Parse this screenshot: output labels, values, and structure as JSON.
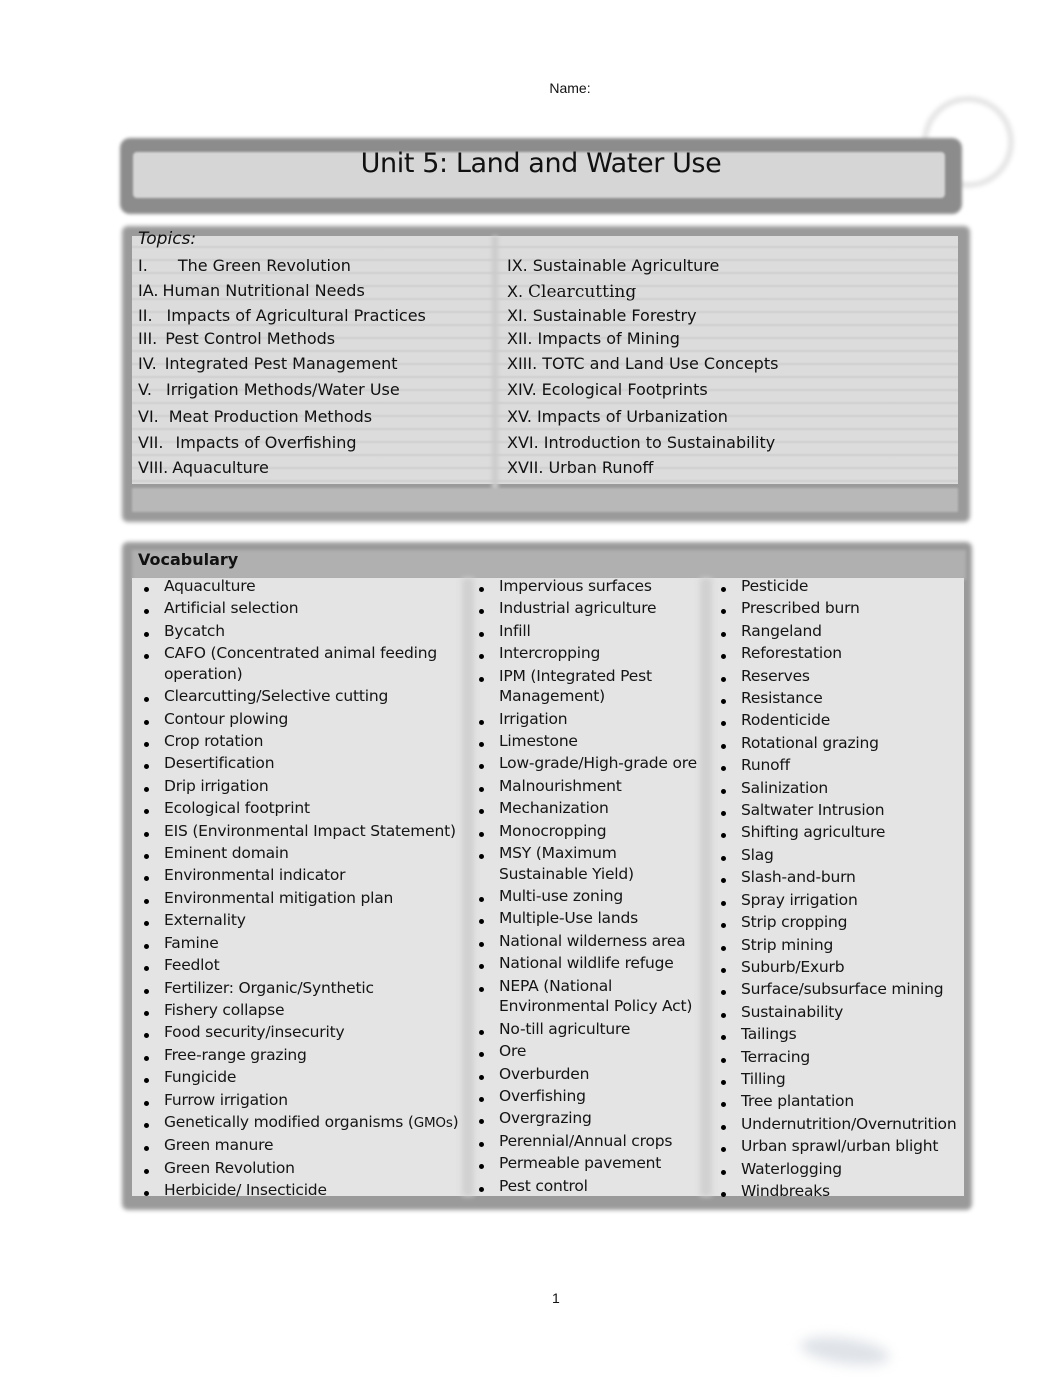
{
  "header": {
    "name_label": "Name:",
    "title": "Unit 5: Land and Water Use"
  },
  "topics": {
    "heading": "Topics:",
    "left": [
      {
        "num": "I.",
        "label": "The Green Revolution"
      },
      {
        "num": "IA.",
        "label": "Human Nutritional Needs"
      },
      {
        "num": "II.",
        "label": "Impacts of Agricultural Practices"
      },
      {
        "num": "III.",
        "label": "Pest Control Methods"
      },
      {
        "num": "IV.",
        "label": "Integrated Pest Management"
      },
      {
        "num": "V.",
        "label": "Irrigation Methods/Water Use"
      },
      {
        "num": "VI.",
        "label": "Meat Production Methods"
      },
      {
        "num": "VII.",
        "label": "Impacts of Overfishing"
      },
      {
        "num": "VIII.",
        "label": "Aquaculture"
      }
    ],
    "right": [
      {
        "num": "IX.",
        "label": "Sustainable Agriculture"
      },
      {
        "num": "X.",
        "label": "Clearcutting"
      },
      {
        "num": "XI.",
        "label": "Sustainable Forestry"
      },
      {
        "num": "XII.",
        "label": "Impacts of Mining"
      },
      {
        "num": "XIII.",
        "label": "TOTC and Land Use Concepts"
      },
      {
        "num": "XIV.",
        "label": "Ecological Footprints"
      },
      {
        "num": "XV.",
        "label": "Impacts of Urbanization"
      },
      {
        "num": "XVI.",
        "label": "Introduction to Sustainability"
      },
      {
        "num": "XVII.",
        "label": "Urban Runoff"
      }
    ]
  },
  "vocabulary": {
    "heading": "Vocabulary",
    "columns": [
      [
        "Aquaculture",
        "Artificial selection",
        "Bycatch",
        "CAFO (Concentrated animal feeding|operation)",
        "Clearcutting/Selective cutting",
        "Contour plowing",
        "Crop rotation",
        "Desertification",
        "Drip irrigation",
        "Ecological footprint",
        "EIS (Environmental Impact Statement)",
        "Eminent domain",
        "Environmental indicator",
        "Environmental mitigation plan",
        "Externality",
        "Famine",
        "Feedlot",
        "Fertilizer: Organic/Synthetic",
        "Fishery collapse",
        "Food security/insecurity",
        "Free-range grazing",
        "Fungicide",
        "Furrow irrigation",
        "Genetically modified organisms (GMOs)",
        "Green manure",
        "Green Revolution",
        "Herbicide/ Insecticide"
      ],
      [
        "Impervious surfaces",
        "Industrial agriculture",
        "Infill",
        "Intercropping",
        "IPM (Integrated Pest|Management)",
        "Irrigation",
        "Limestone",
        "Low-grade/High-grade ore",
        "Malnourishment",
        "Mechanization",
        "Monocropping",
        "MSY (Maximum|Sustainable Yield)",
        "Multi-use zoning",
        "Multiple-Use lands",
        "National wilderness area",
        "National wildlife refuge",
        "NEPA (National|Environmental  Policy Act)",
        "No-till agriculture",
        "Ore",
        "Overburden",
        "Overfishing",
        "Overgrazing",
        "Perennial/Annual crops",
        "Permeable pavement",
        "Pest control"
      ],
      [
        "Pesticide",
        "Prescribed burn",
        "Rangeland",
        "Reforestation",
        "Reserves",
        "Resistance",
        "Rodenticide",
        "Rotational grazing",
        "Runoff",
        "Salinization",
        "Saltwater Intrusion",
        "Shifting agriculture",
        "Slag",
        "Slash-and-burn",
        "Spray irrigation",
        "Strip cropping",
        "Strip mining",
        "Suburb/Exurb",
        "Surface/subsurface mining",
        "Sustainability",
        "Tailings",
        "Terracing",
        "Tilling",
        "Tree plantation",
        "Undernutrition/Overnutrition",
        "Urban sprawl/urban blight",
        "Waterlogging",
        "Windbreaks"
      ]
    ]
  },
  "footer": {
    "page_number": "1"
  }
}
